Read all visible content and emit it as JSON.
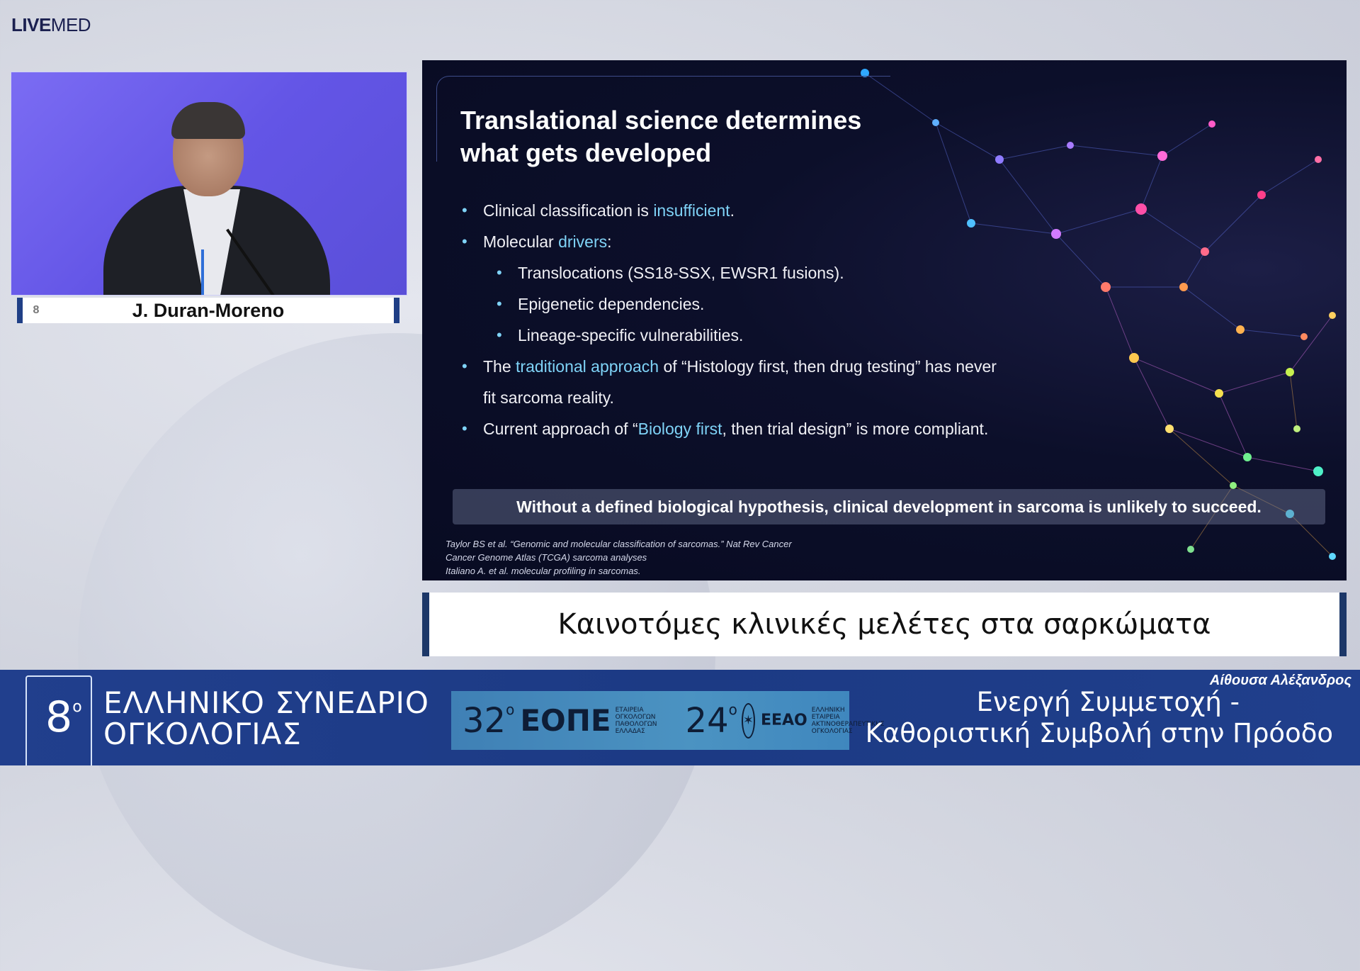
{
  "brand": {
    "live": "LIVE",
    "med": "MED"
  },
  "speaker": {
    "name": "J. Duran-Moreno",
    "badge": "8"
  },
  "slide": {
    "title_line1": "Translational science determines",
    "title_line2": "what gets developed",
    "b1_pre": "Clinical classification is ",
    "b1_hl": "insufficient",
    "b1_post": ".",
    "b2_pre": "Molecular ",
    "b2_hl": "drivers",
    "b2_post": ":",
    "s1": "Translocations (SS18-SSX, EWSR1 fusions).",
    "s2": "Epigenetic dependencies.",
    "s3": "Lineage-specific vulnerabilities.",
    "b3_pre": "The ",
    "b3_hl": "traditional approach",
    "b3_post": " of “Histology first, then drug testing” has never",
    "b3_line2": "fit sarcoma reality.",
    "b4_pre": "Current approach of “",
    "b4_hl": "Biology first",
    "b4_post": ", then trial design” is more compliant.",
    "callout": "Without a defined biological hypothesis, clinical development in sarcoma is unlikely to succeed.",
    "ref1": "Taylor BS et al. “Genomic and molecular classification of sarcomas.” Nat Rev Cancer",
    "ref2": "Cancer Genome Atlas (TCGA) sarcoma analyses",
    "ref3": "Italiano A. et al. molecular profiling in sarcomas."
  },
  "session_title": "Καινοτόμες κλινικές μελέτες στα σαρκώματα",
  "footer": {
    "congress_number": "8",
    "congress_sup": "ο",
    "line1": "ΕΛΛΗΝΙΚΟ ΣΥΝΕΔΡΙΟ",
    "line2": "ΟΓΚΟΛΟΓΙΑΣ",
    "logo1_num": "32",
    "logo1_sup": "ο",
    "logo1_name": "ΕΟΠΕ",
    "logo1_small": "ΕΤΑΙΡΕΙΑ ΟΓΚΟΛΟΓΩΝ ΠΑΘΟΛΟΓΩΝ ΕΛΛΑΔΑΣ",
    "logo2_num": "24",
    "logo2_sup": "ο",
    "logo2_name": "ΕΕΑΟ",
    "logo2_small": "ΕΛΛΗΝΙΚΗ ΕΤΑΙΡΕΙΑ ΑΚΤΙΝΟΘΕΡΑΠΕΥΤΙΚΗΣ ΟΓΚΟΛΟΓΙΑΣ",
    "room": "Αίθουσα Αλέξανδρος",
    "motto1": "Ενεργή Συμμετοχή -",
    "motto2": "Καθοριστική Συμβολή στην Πρόοδο"
  }
}
